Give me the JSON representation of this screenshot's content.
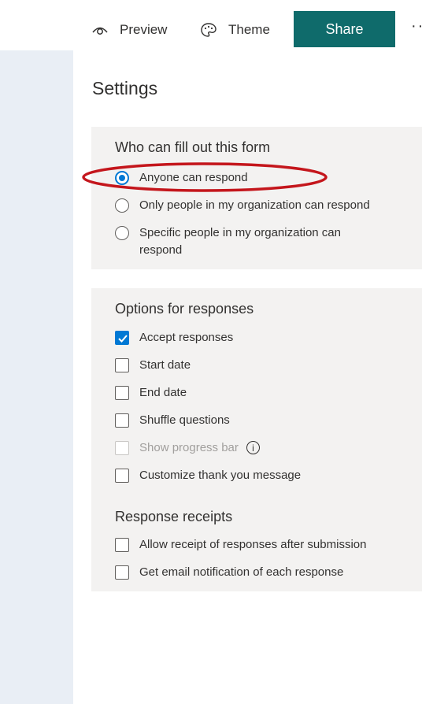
{
  "toolbar": {
    "preview_label": "Preview",
    "theme_label": "Theme",
    "share_label": "Share",
    "more_label": "··"
  },
  "page": {
    "title": "Settings"
  },
  "who_can_fill": {
    "title": "Who can fill out this form",
    "options": [
      {
        "label": "Anyone can respond",
        "selected": true
      },
      {
        "label": "Only people in my organization can respond",
        "selected": false
      },
      {
        "label_line1": "Specific people in my organization can",
        "label_line2": "respond",
        "selected": false
      }
    ]
  },
  "options_for_responses": {
    "title": "Options for responses",
    "items": [
      {
        "label": "Accept responses",
        "checked": true,
        "disabled": false
      },
      {
        "label": "Start date",
        "checked": false,
        "disabled": false
      },
      {
        "label": "End date",
        "checked": false,
        "disabled": false
      },
      {
        "label": "Shuffle questions",
        "checked": false,
        "disabled": false
      },
      {
        "label": "Show progress bar",
        "checked": false,
        "disabled": true,
        "info_icon": "i"
      },
      {
        "label": "Customize thank you message",
        "checked": false,
        "disabled": false
      }
    ]
  },
  "response_receipts": {
    "title": "Response receipts",
    "items": [
      {
        "label": "Allow receipt of responses after submission",
        "checked": false
      },
      {
        "label": "Get email notification of each response",
        "checked": false
      }
    ]
  },
  "colors": {
    "share_bg": "#0f6b6b",
    "accent": "#0078d4",
    "annotation": "#c4161c",
    "panel_bg": "#f3f2f1",
    "rail_bg": "#e9eef5"
  },
  "icons": {
    "preview": "eye-icon",
    "theme": "palette-icon",
    "checkmark": "checkmark-icon",
    "info": "info-icon"
  }
}
